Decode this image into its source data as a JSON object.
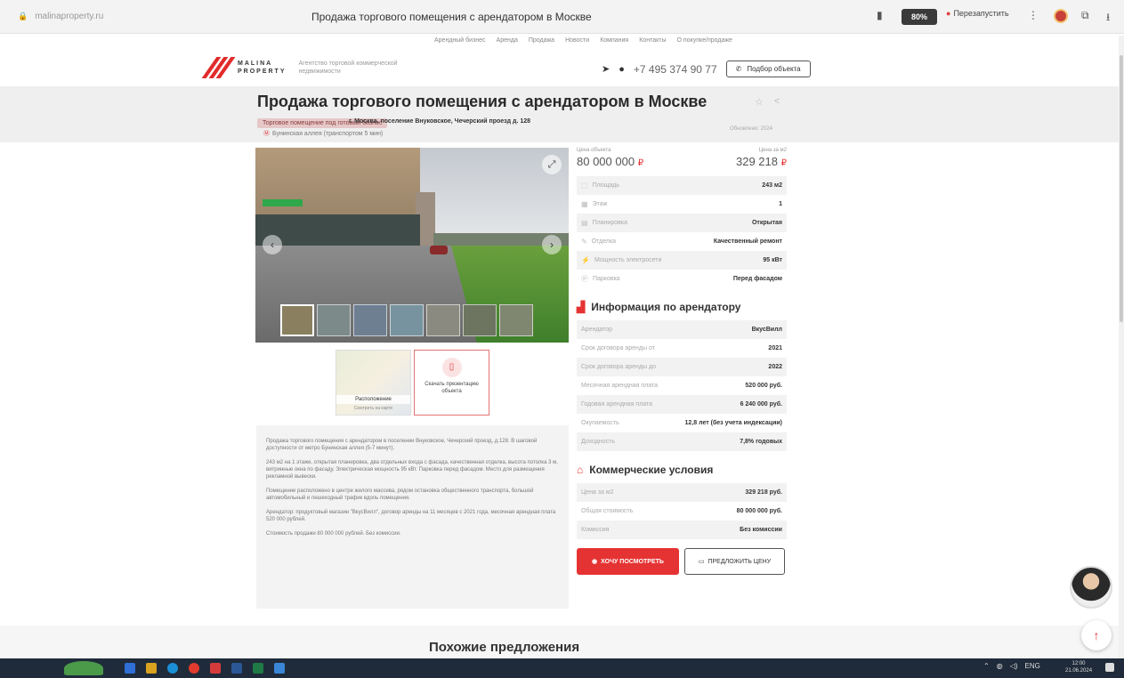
{
  "browser": {
    "url": "malinaproperty.ru",
    "tab_title": "Продажа торгового помещения с арендатором в Москве",
    "zoom": "80%",
    "reload_label": "Перезапустить"
  },
  "top_nav": [
    "Арендный бизнес",
    "Аренда",
    "Продажа",
    "Новости",
    "Компания",
    "Контакты",
    "О покупке/продаже"
  ],
  "header": {
    "logo_line1": "MALINA",
    "logo_line2": "PROPERTY",
    "logo_tagline": "Агентство торговой коммерческой недвижимости",
    "phone": "+7 495 374 90 77",
    "call_button": "Подбор объекта"
  },
  "listing": {
    "title": "Продажа торгового помещения с арендатором в Москве",
    "badge": "Торговое помещение под готовый бизнес",
    "address": "г. Москва, поселение Внуковское, Чечерский проезд д. 128",
    "metro": "Бунинская аллея (транспортом 5 мин)",
    "date": "Обновлено: 2024"
  },
  "gallery": {
    "thumb_count": 7,
    "map_label": "Расположение",
    "map_sub": "Смотреть на карте",
    "object_label": "Скачать презентацию объекта"
  },
  "description": {
    "paragraphs": [
      "Продажа торгового помещения с арендатором в поселении Внуковское, Чечерский проезд, д.128. В шаговой доступности от метро Бунинская аллея (5-7 минут).",
      "243 м2 на 1 этаже, открытая планировка, два отдельных входа с фасада, качественная отделка, высота потолка 3 м, витринные окна по фасаду. Электрическая мощность 95 кВт. Парковка перед фасадом. Место для размещения рекламной вывески.",
      "Помещение расположено в центре жилого массива, рядом остановка общественного транспорта, большой автомобильный и пешеходный трафик вдоль помещения.",
      "Арендатор: продуктовый магазин \"ВкусВилл\", договор аренды на 11 месяцев с 2021 года, месячная арендная плата 520 000 рублей.",
      "Стоимость продажи 80 000 000 рублей. Без комиссии."
    ]
  },
  "pricing": {
    "price_label": "Цена объекта",
    "price_value": "80 000 000",
    "price_per_m2_label": "Цена за м2",
    "price_per_m2_value": "329 218",
    "currency_icon": "ruble-icon"
  },
  "params": [
    {
      "icon": "area-icon",
      "key": "Площадь",
      "value": "243 м2"
    },
    {
      "icon": "floor-icon",
      "key": "Этаж",
      "value": "1"
    },
    {
      "icon": "layout-icon",
      "key": "Планировка",
      "value": "Открытая"
    },
    {
      "icon": "finish-icon",
      "key": "Отделка",
      "value": "Качественный ремонт"
    },
    {
      "icon": "power-icon",
      "key": "Мощность электросети",
      "value": "95 кВт"
    },
    {
      "icon": "parking-icon",
      "key": "Парковка",
      "value": "Перед фасадом"
    }
  ],
  "tenant": {
    "title": "Информация по арендатору",
    "rows": [
      {
        "key": "Арендатор",
        "value": "ВкусВилл"
      },
      {
        "key": "Срок договора аренды от",
        "value": "2021"
      },
      {
        "key": "Срок договора аренды до",
        "value": "2022"
      },
      {
        "key": "Месячная арендная плата",
        "value": "520 000 руб."
      },
      {
        "key": "Годовая арендная плата",
        "value": "6 240 000 руб."
      },
      {
        "key": "Окупаемость",
        "value": "12,8 лет (без учета индексации)"
      },
      {
        "key": "Доходность",
        "value": "7,8% годовых"
      }
    ]
  },
  "commercial": {
    "title": "Коммерческие условия",
    "rows": [
      {
        "key": "Цена за м2",
        "value": "329 218 руб."
      },
      {
        "key": "Общая стоимость",
        "value": "80 000 000 руб."
      },
      {
        "key": "Комиссия",
        "value": "Без комиссии"
      }
    ]
  },
  "actions": {
    "primary": "ХОЧУ ПОСМОТРЕТЬ",
    "secondary": "ПРЕДЛОЖИТЬ ЦЕНУ"
  },
  "similar": {
    "title": "Похожие предложения"
  },
  "taskbar": {
    "time": "12:00",
    "date": "21.06.2024",
    "lang": "ENG"
  },
  "colors": {
    "accent": "#e53333",
    "band": "#efefef"
  }
}
